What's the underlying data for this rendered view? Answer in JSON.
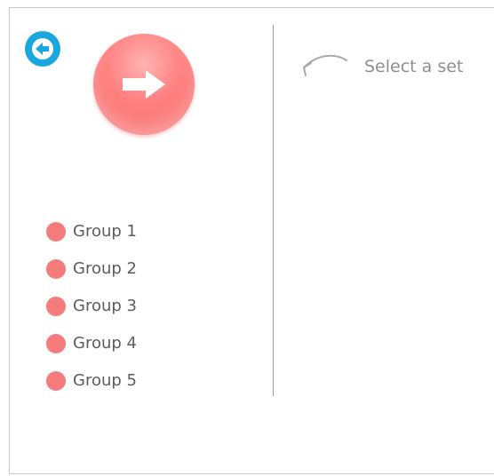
{
  "header": {
    "back_icon": "arrow-left-circle-icon",
    "play_icon": "arrow-right-icon",
    "accent_color": "#1aa7e0",
    "play_color": "#f47c7c"
  },
  "groups": [
    {
      "label": "Group 1"
    },
    {
      "label": "Group 2"
    },
    {
      "label": "Group 3"
    },
    {
      "label": "Group 4"
    },
    {
      "label": "Group 5"
    }
  ],
  "hint": {
    "text": "Select a set",
    "icon": "curved-arrow-left-icon"
  }
}
